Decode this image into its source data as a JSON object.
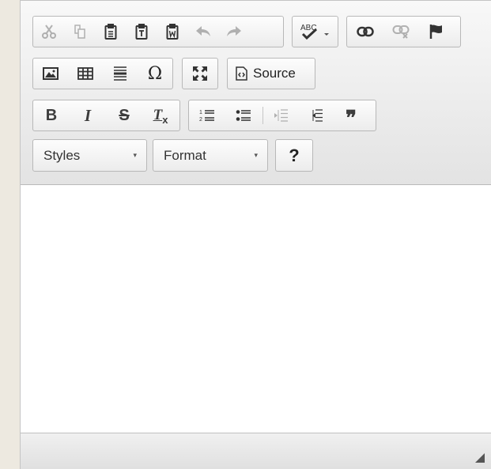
{
  "toolbar": {
    "row1_clipboard": [
      "cut-icon",
      "copy-icon",
      "paste-icon",
      "paste-text-icon",
      "paste-word-icon",
      "undo-icon",
      "redo-icon"
    ],
    "spellcheck_label": "ABC",
    "row1_links": [
      "link-icon",
      "unlink-icon",
      "anchor-flag-icon"
    ],
    "row2_insert": [
      "image-icon",
      "table-icon",
      "horizontal-line-icon",
      "special-char-icon"
    ],
    "special_char_glyph": "Ω",
    "maximize_icon": "maximize-icon",
    "source_label": "Source",
    "bold_label": "B",
    "italic_label": "I",
    "strike_label": "S",
    "remove_format_label": "T",
    "remove_format_sub": "x",
    "blockquote_label": "❞",
    "styles_label": "Styles",
    "format_label": "Format",
    "help_label": "?"
  },
  "colors": {
    "toolbar_bg": "#e8e8e8",
    "icon": "#3d3d3d",
    "page_bg": "#ede9e0"
  }
}
